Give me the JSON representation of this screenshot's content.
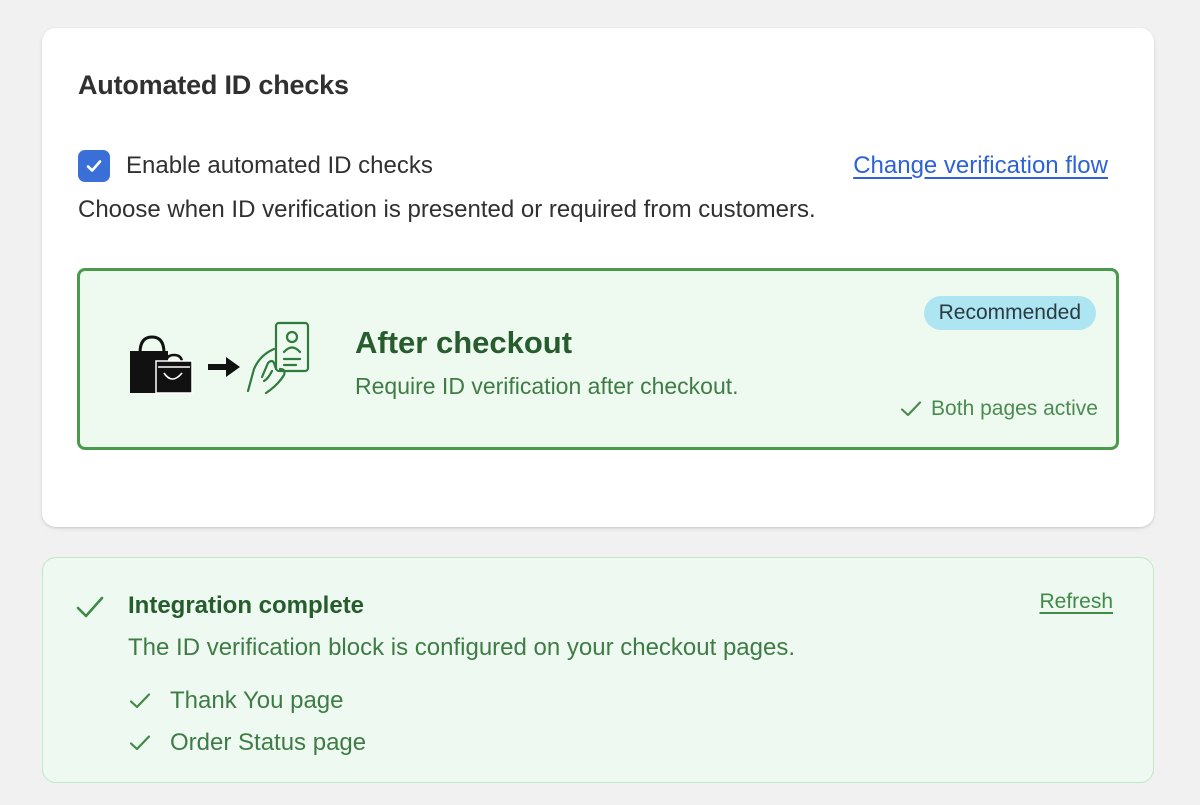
{
  "card": {
    "title": "Automated ID checks",
    "enable_label": "Enable automated ID checks",
    "enable_checked": true,
    "change_link": "Change verification flow",
    "help_text": "Choose when ID verification is presented or required from customers.",
    "option": {
      "title": "After checkout",
      "description": "Require ID verification after checkout.",
      "badge": "Recommended",
      "status": "Both pages active",
      "illustration_icons": [
        "shopping-bags-icon",
        "arrow-right-icon",
        "hand-holding-id-card-icon"
      ]
    }
  },
  "banner": {
    "title": "Integration complete",
    "description": "The ID verification block is configured on your checkout pages.",
    "refresh_link": "Refresh",
    "pages": [
      {
        "label": "Thank You page"
      },
      {
        "label": "Order Status page"
      }
    ]
  },
  "colors": {
    "accent_blue": "#2e62d9",
    "checkbox_blue": "#3a6fd8",
    "success_green": "#4a9a4e",
    "success_text": "#275c2d",
    "badge_bg": "#aee5f3"
  }
}
